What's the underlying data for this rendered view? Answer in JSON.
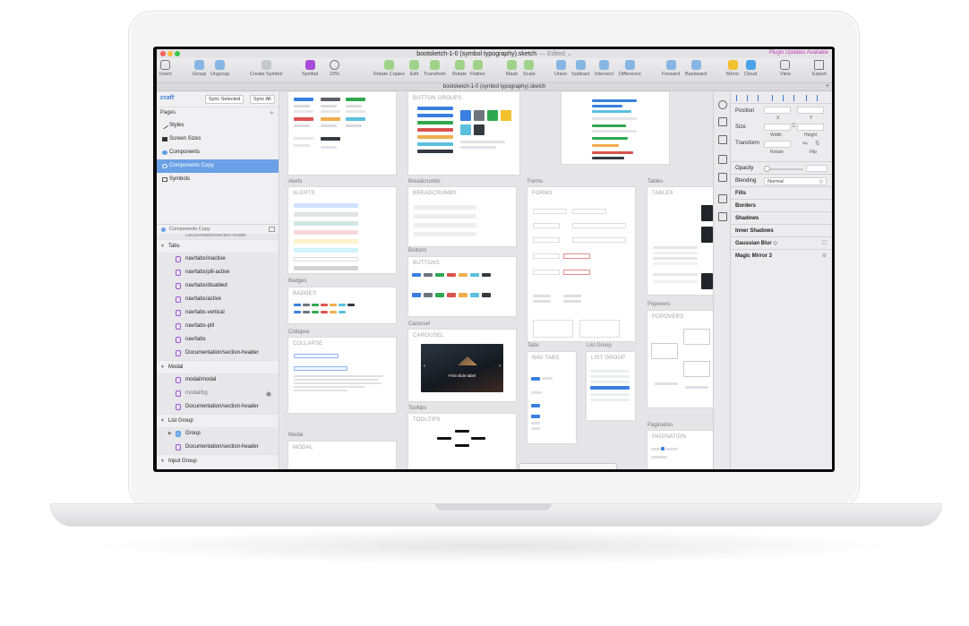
{
  "window": {
    "title": "bootsketch-1-0 (symbol typography).sketch",
    "edited": "— Edited ⌄",
    "plugin_updates": "Plugin Updates Available",
    "document_tab": "bootsketch-1-0 (symbol typography).sketch"
  },
  "toolbar": {
    "insert": "Insert",
    "group": "Group",
    "ungroup": "Ungroup",
    "create_symbol": "Create Symbol",
    "symbol": "Symbol",
    "zoom_value": "23%",
    "rotate_copies": "Rotate Copies",
    "edit": "Edit",
    "transform": "Transform",
    "rotate": "Rotate",
    "flatten": "Flatten",
    "mask": "Mask",
    "scale": "Scale",
    "union": "Union",
    "subtract": "Subtract",
    "intersect": "Intersect",
    "difference": "Difference",
    "forward": "Forward",
    "backward": "Backward",
    "mirror": "Mirror",
    "cloud": "Cloud",
    "view": "View",
    "export": "Export"
  },
  "sidebar": {
    "sync_selected": "Sync Selected",
    "sync_all": "Sync All",
    "pages_label": "Pages",
    "pages": [
      {
        "label": "Styles"
      },
      {
        "label": "Screen Sizes"
      },
      {
        "label": "Components"
      },
      {
        "label": "Components Copy"
      },
      {
        "label": "Symbols"
      }
    ],
    "layers_header": "Components Copy",
    "cut_off_layer": "Documentation/section-header",
    "groups": [
      {
        "label": "Tabs",
        "items": [
          "nav/tabs/inactive",
          "nav/tabs/pill-active",
          "nav/tabs/disabled",
          "nav/tabs/active",
          "nav/tabs-vertical",
          "nav/tabs-pill",
          "nav/tabs",
          "Documentation/section-header"
        ]
      },
      {
        "label": "Modal",
        "items": [
          "modal/modal",
          "modal/bg",
          "Documentation/section-header"
        ]
      },
      {
        "label": "List Group",
        "items": [
          "Group",
          "Documentation/section-header"
        ]
      },
      {
        "label": "Input Group",
        "items": []
      }
    ]
  },
  "canvas": {
    "sections": {
      "alerts": "Alerts",
      "breadcrumbs": "Breadcrumbs",
      "forms": "Forms",
      "tables": "Tables",
      "badges": "Badges",
      "buttons": "Buttons",
      "collapse": "Collapse",
      "carousel": "Carousel",
      "tabs": "Tabs",
      "list_group": "List Group",
      "popovers": "Popovers",
      "tooltips": "Tooltips",
      "modal": "Modal",
      "pagination": "Pagination"
    },
    "artboards": {
      "button_groups": "BUTTON GROUPS",
      "alerts": "ALERTS",
      "breadcrumbs": "BREADCRUMBS",
      "forms": "FORMS",
      "tables": "TABLES",
      "badges": "BADGES",
      "buttons": "BUTTONS",
      "collapse": "COLLAPSE",
      "carousel": "CAROUSEL",
      "nav_tabs": "NAV TABS",
      "list_group": "LIST GROUP",
      "popovers": "POPOVERS",
      "tooltips": "TOOLTIPS",
      "modal": "MODAL",
      "pagination": "PAGINATION"
    },
    "carousel_caption": "First slide label"
  },
  "inspector": {
    "position": "Position",
    "x": "X",
    "y": "Y",
    "size": "Size",
    "width": "Width",
    "height": "Height",
    "transform": "Transform",
    "rotate": "Rotate",
    "flip": "Flip",
    "opacity": "Opacity",
    "blending": "Blending",
    "blending_value": "Normal",
    "fills": "Fills",
    "borders": "Borders",
    "shadows": "Shadows",
    "inner_shadows": "Inner Shadows",
    "gaussian_blur": "Gaussian Blur ◇",
    "magic_mirror": "Magic Mirror 3"
  },
  "colors": {
    "selection": "#6ba0e6",
    "symbol_purple": "#a04dd6",
    "plugin_pink": "#c23fb5"
  }
}
